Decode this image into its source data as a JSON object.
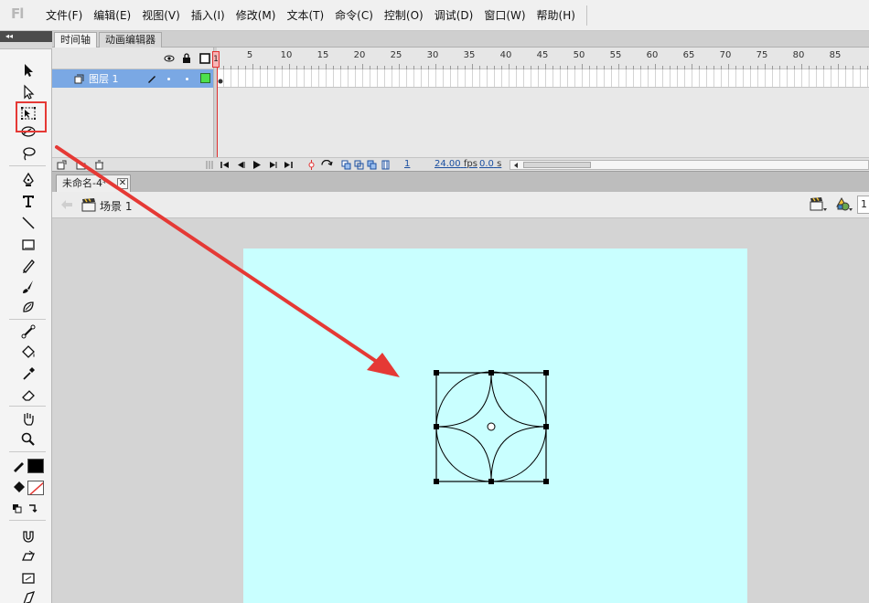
{
  "app": {
    "logo": "Fl"
  },
  "menu": [
    {
      "name": "file",
      "label": "文件(F)"
    },
    {
      "name": "edit",
      "label": "编辑(E)"
    },
    {
      "name": "view",
      "label": "视图(V)"
    },
    {
      "name": "insert",
      "label": "插入(I)"
    },
    {
      "name": "modify",
      "label": "修改(M)"
    },
    {
      "name": "text",
      "label": "文本(T)"
    },
    {
      "name": "commands",
      "label": "命令(C)"
    },
    {
      "name": "control",
      "label": "控制(O)"
    },
    {
      "name": "debug",
      "label": "调试(D)"
    },
    {
      "name": "window",
      "label": "窗口(W)"
    },
    {
      "name": "help",
      "label": "帮助(H)"
    }
  ],
  "tools_panel": {
    "collapse_glyph": "◂◂",
    "selected_tool": "free-transform-tool",
    "highlight_color": "#e53935",
    "stroke_color": "#000000",
    "fill_color": "none"
  },
  "timeline": {
    "tabs": {
      "timeline": "时间轴",
      "motion_editor": "动画编辑器"
    },
    "ruler_numbers": [
      "1",
      "5",
      "10",
      "15",
      "20",
      "25",
      "30",
      "35",
      "40",
      "45",
      "50",
      "55",
      "60",
      "65",
      "70",
      "75",
      "80",
      "85",
      "9"
    ],
    "layer": {
      "name": "图层 1",
      "selected_color": "#7aa8e4"
    },
    "current_frame": "1",
    "status": {
      "frame": "1",
      "fps": "24.00",
      "fps_unit": "fps",
      "time": "0.0",
      "time_unit": "s"
    }
  },
  "document": {
    "tab_title": "未命名-4*",
    "close_glyph": "✕",
    "scene_label": "场景 1",
    "zoom_value": "1",
    "stage_color": "#c9ffff",
    "annotation_arrow_color": "#e53935"
  }
}
